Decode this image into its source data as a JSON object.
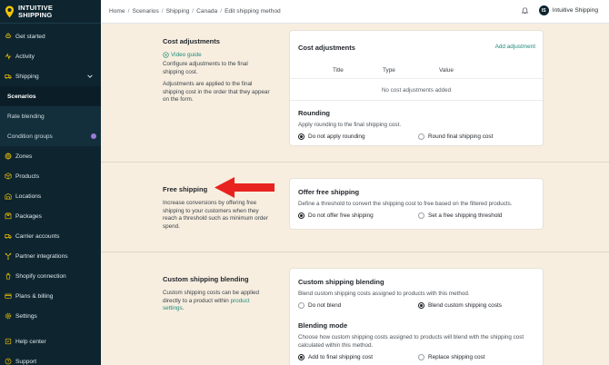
{
  "brand": {
    "line1": "INTUITIVE",
    "line2": "SHIPPING"
  },
  "sidebar": {
    "items": [
      {
        "label": "Get started",
        "icon": "rocket-icon"
      },
      {
        "label": "Activity",
        "icon": "activity-icon"
      },
      {
        "label": "Shipping",
        "icon": "shipping-icon",
        "expanded": true
      },
      {
        "label": "Zones",
        "icon": "globe-icon"
      },
      {
        "label": "Products",
        "icon": "box-icon"
      },
      {
        "label": "Locations",
        "icon": "warehouse-icon"
      },
      {
        "label": "Packages",
        "icon": "package-icon"
      },
      {
        "label": "Carrier accounts",
        "icon": "truck-icon"
      },
      {
        "label": "Partner integrations",
        "icon": "integration-icon"
      },
      {
        "label": "Shopify connection",
        "icon": "shopify-icon"
      },
      {
        "label": "Plans & billing",
        "icon": "billing-icon"
      },
      {
        "label": "Settings",
        "icon": "gear-icon"
      },
      {
        "label": "Help center",
        "icon": "help-icon"
      },
      {
        "label": "Support",
        "icon": "support-icon"
      }
    ],
    "subitems": [
      {
        "label": "Scenarios",
        "active": true
      },
      {
        "label": "Rate blending"
      },
      {
        "label": "Condition groups",
        "badge": true
      }
    ]
  },
  "breadcrumb": [
    "Home",
    "Scenarios",
    "Shipping",
    "Canada",
    "Edit shipping method"
  ],
  "account": {
    "initials": "IS",
    "name": "Intuitive Shipping"
  },
  "sections": {
    "cost": {
      "title": "Cost adjustments",
      "video_label": "Video guide",
      "desc1": "Configure adjustments to the final shipping cost.",
      "desc2": "Adjustments are applied to the final shipping cost in the order that they appear on the form.",
      "card_title": "Cost adjustments",
      "add_label": "Add adjustment",
      "columns": [
        "Title",
        "Type",
        "Value"
      ],
      "empty": "No cost adjustments added",
      "rounding_title": "Rounding",
      "rounding_sub": "Apply rounding to the final shipping cost.",
      "rounding_options": [
        "Do not apply rounding",
        "Round final shipping cost"
      ]
    },
    "free": {
      "title": "Free shipping",
      "desc": "Increase conversions by offering free shipping to your customers when they reach a threshold such as minimum order spend.",
      "card_title": "Offer free shipping",
      "card_sub": "Define a threshold to convert the shipping cost to free based on the filtered products.",
      "options": [
        "Do not offer free shipping",
        "Set a free shipping threshold"
      ]
    },
    "blend": {
      "title": "Custom shipping blending",
      "desc_pre": "Custom shipping costs can be applied directly to a product within ",
      "desc_link": "product settings",
      "desc_post": ".",
      "card_title": "Custom shipping blending",
      "card_sub": "Blend custom shipping costs assigned to products with this method.",
      "options": [
        "Do not blend",
        "Blend custom shipping costs"
      ],
      "mode_title": "Blending mode",
      "mode_sub": "Choose how custom shipping costs assigned to products will blend with the shipping cost calculated within this method.",
      "mode_options": [
        "Add to final shipping cost",
        "Replace shipping cost"
      ]
    }
  },
  "colors": {
    "sidebar": "#0e2530",
    "accent": "#1f8c7a",
    "page": "#f7eee0",
    "arrow": "#e8231f"
  }
}
